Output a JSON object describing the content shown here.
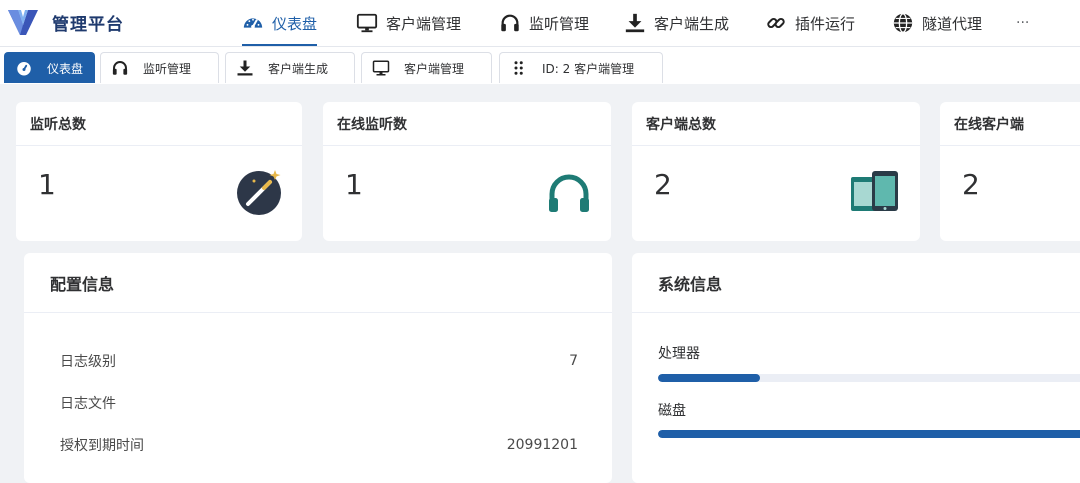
{
  "app": {
    "title": "管理平台"
  },
  "nav": {
    "items": [
      {
        "label": "仪表盘",
        "icon": "dashboard-gauge-icon",
        "active": true
      },
      {
        "label": "客户端管理",
        "icon": "monitor-icon"
      },
      {
        "label": "监听管理",
        "icon": "headphones-icon"
      },
      {
        "label": "客户端生成",
        "icon": "download-icon"
      },
      {
        "label": "插件运行",
        "icon": "link-icon"
      },
      {
        "label": "隧道代理",
        "icon": "globe-icon"
      }
    ],
    "more": "···"
  },
  "tabs": [
    {
      "label": "仪表盘",
      "icon": "dashboard-gauge-icon",
      "active": true
    },
    {
      "label": "监听管理",
      "icon": "headphones-icon"
    },
    {
      "label": "客户端生成",
      "icon": "download-icon"
    },
    {
      "label": "客户端管理",
      "icon": "monitor-icon"
    },
    {
      "label": "ID: 2 客户端管理",
      "icon": "drag-handle-icon"
    }
  ],
  "stats": [
    {
      "title": "监听总数",
      "value": "1",
      "icon": "magic-wand-icon"
    },
    {
      "title": "在线监听数",
      "value": "1",
      "icon": "headphones-icon"
    },
    {
      "title": "客户端总数",
      "value": "2",
      "icon": "devices-icon"
    },
    {
      "title": "在线客户端",
      "value": "2"
    }
  ],
  "config": {
    "title": "配置信息",
    "rows": [
      {
        "label": "日志级别",
        "value": "7"
      },
      {
        "label": "日志文件",
        "value": ""
      },
      {
        "label": "授权到期时间",
        "value": "20991201"
      }
    ]
  },
  "system": {
    "title": "系统信息",
    "metrics": [
      {
        "label": "处理器",
        "percent": 23
      },
      {
        "label": "磁盘",
        "percent": 100
      }
    ]
  },
  "colors": {
    "accent": "#1f5fa8",
    "teal": "#1e7b75",
    "background": "#f0f2f5"
  }
}
